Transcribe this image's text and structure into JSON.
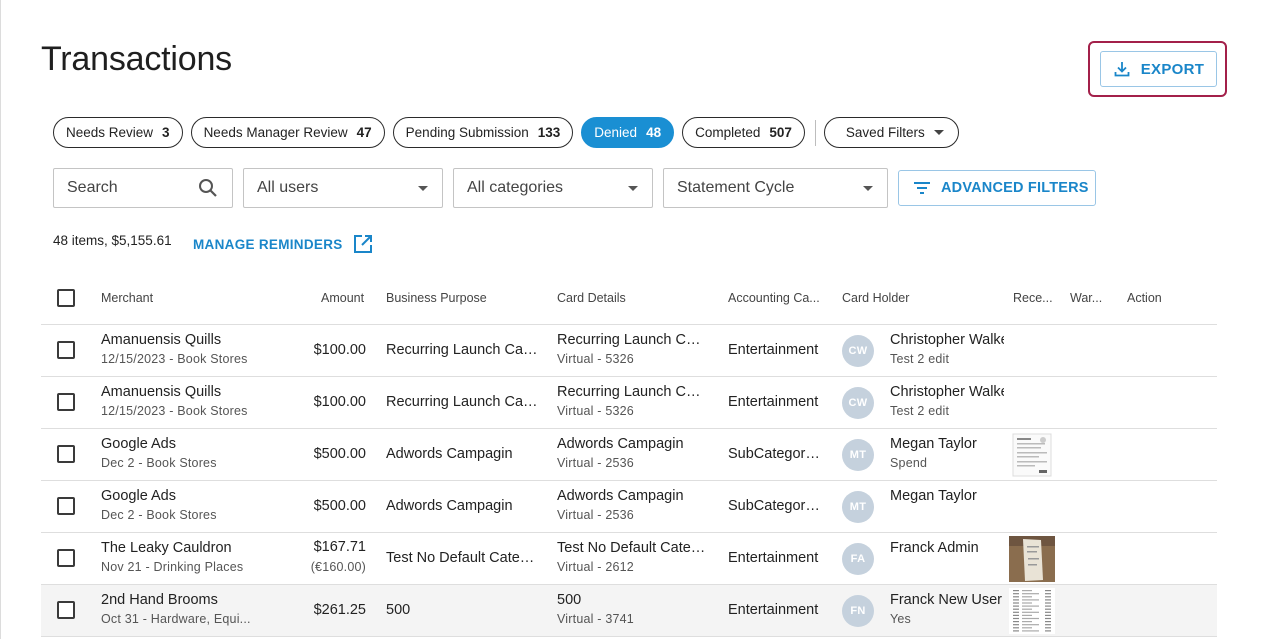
{
  "page": {
    "title": "Transactions"
  },
  "export": {
    "label": "EXPORT",
    "icon": "download-icon",
    "highlight_color": "#a3204a"
  },
  "chips": [
    {
      "label": "Needs Review",
      "count": "3"
    },
    {
      "label": "Needs Manager Review",
      "count": "47"
    },
    {
      "label": "Pending Submission",
      "count": "133"
    },
    {
      "label": "Denied",
      "count": "48",
      "active": true
    },
    {
      "label": "Completed",
      "count": "507"
    }
  ],
  "saved_filters": {
    "label": "Saved Filters"
  },
  "filters": {
    "search_placeholder": "Search",
    "users": "All users",
    "categories": "All categories",
    "statement_cycle": "Statement Cycle",
    "advanced_label": "ADVANCED FILTERS"
  },
  "summary": {
    "text": "48 items, $5,155.61",
    "reminders_label": "MANAGE REMINDERS"
  },
  "colors": {
    "accent": "#1a86c9",
    "active_chip": "#1a8fd3",
    "avatar": "#c5d1dd"
  },
  "table": {
    "columns": {
      "merchant": "Merchant",
      "amount": "Amount",
      "purpose": "Business Purpose",
      "card": "Card Details",
      "accounting": "Accounting Ca...",
      "holder": "Card Holder",
      "receipt": "Rece...",
      "warning": "War...",
      "action": "Action"
    },
    "rows": [
      {
        "merchant": "Amanuensis Quills",
        "merchant_sub": "12/15/2023 - Book Stores",
        "amount": "$100.00",
        "amount_sub": "",
        "purpose": "Recurring Launch Car...",
        "card": "Recurring Launch Car...",
        "card_sub": "Virtual - 5326",
        "accounting": "Entertainment",
        "initials": "CW",
        "holder": "Christopher Walke",
        "holder_sub": "Test 2 edit",
        "receipt": false
      },
      {
        "merchant": "Amanuensis Quills",
        "merchant_sub": "12/15/2023 - Book Stores",
        "amount": "$100.00",
        "amount_sub": "",
        "purpose": "Recurring Launch Car...",
        "card": "Recurring Launch Car...",
        "card_sub": "Virtual - 5326",
        "accounting": "Entertainment",
        "initials": "CW",
        "holder": "Christopher Walke",
        "holder_sub": "Test 2 edit",
        "receipt": false
      },
      {
        "merchant": "Google Ads",
        "merchant_sub": "Dec 2 - Book Stores",
        "amount": "$500.00",
        "amount_sub": "",
        "purpose": "Adwords Campagin",
        "card": "Adwords Campagin",
        "card_sub": "Virtual - 2536",
        "accounting": "SubCategory...",
        "initials": "MT",
        "holder": "Megan Taylor",
        "holder_sub": "Spend",
        "receipt": "doc"
      },
      {
        "merchant": "Google Ads",
        "merchant_sub": "Dec 2 - Book Stores",
        "amount": "$500.00",
        "amount_sub": "",
        "purpose": "Adwords Campagin",
        "card": "Adwords Campagin",
        "card_sub": "Virtual - 2536",
        "accounting": "SubCategory...",
        "initials": "MT",
        "holder": "Megan Taylor",
        "holder_sub": "",
        "receipt": false
      },
      {
        "merchant": "The Leaky Cauldron",
        "merchant_sub": "Nov 21 - Drinking Places",
        "amount": "$167.71",
        "amount_sub": "(€160.00)",
        "purpose": "Test No Default Categ...",
        "card": "Test No Default Categ...",
        "card_sub": "Virtual - 2612",
        "accounting": "Entertainment",
        "initials": "FA",
        "holder": "Franck Admin",
        "holder_sub": "",
        "receipt": "photo"
      },
      {
        "merchant": "2nd Hand Brooms",
        "merchant_sub": "Oct 31 - Hardware, Equi...",
        "amount": "$261.25",
        "amount_sub": "",
        "purpose": "500",
        "card": "500",
        "card_sub": "Virtual - 3741",
        "accounting": "Entertainment",
        "initials": "FN",
        "holder": "Franck New User",
        "holder_sub": "Yes",
        "receipt": "list"
      }
    ]
  }
}
